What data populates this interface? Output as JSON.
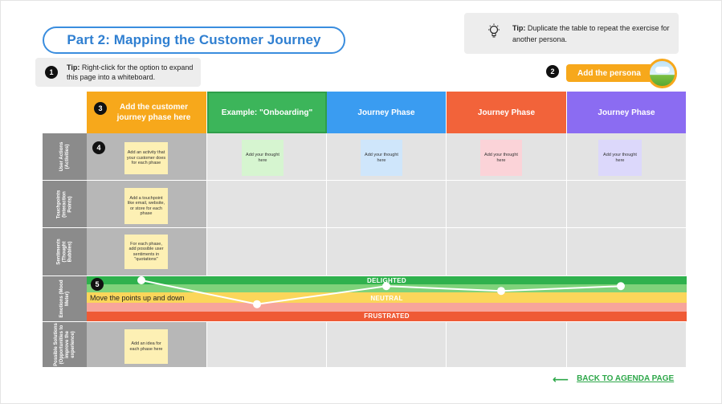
{
  "title": "Part 2: Mapping the Customer Journey",
  "tip_whiteboard": {
    "badge": "1",
    "prefix": "Tip:",
    "text": "Right-click for the option to expand this page into a whiteboard."
  },
  "tip_duplicate": {
    "prefix": "Tip:",
    "text": "Duplicate the table to repeat the exercise for another persona.",
    "icon": "lightbulb-icon"
  },
  "persona": {
    "badge": "2",
    "label": "Add the persona",
    "color": "#f7a81b"
  },
  "phases": [
    {
      "badge": "3",
      "label": "Add the customer journey phase here",
      "color": "#f7a81b"
    },
    {
      "label": "Example: \"Onboarding\"",
      "color": "#3cb55a"
    },
    {
      "label": "Journey Phase",
      "color": "#3a9cf1"
    },
    {
      "label": "Journey Phase",
      "color": "#f2633a"
    },
    {
      "label": "Journey Phase",
      "color": "#8b6cf2"
    }
  ],
  "rows": [
    {
      "label": "User Actions (Activities)"
    },
    {
      "label": "Touchpoints (Interaction Points)"
    },
    {
      "label": "Sentiments (Thought Bubbles)"
    },
    {
      "label": "Emotions (Mood Meter)"
    },
    {
      "label": "Possible Solutions (Opportunities to improve the experience)"
    }
  ],
  "notes": {
    "badge4": "4",
    "actions": "Add an activity that your customer does for each phase",
    "touchpoints": "Add a touchpoint like email, website, or store for each phase",
    "sentiments": "For each phase, add possible user sentiments in \"quotations\"",
    "solutions": "Add an idea for each phase here",
    "thought": "Add your thought here",
    "colors": {
      "yellow": "#fdf0b4",
      "green": "#d6f5d0",
      "blue": "#cfe6fb",
      "pink": "#fbd3d8",
      "purple": "#dcd8fb"
    }
  },
  "emotions": {
    "badge": "5",
    "delighted": "DELIGHTED",
    "neutral": "NEUTRAL",
    "frustrated": "FRUSTRATED",
    "instruction": "Move the points up and down",
    "points": [
      1.0,
      0.1,
      0.78,
      0.6,
      0.78
    ]
  },
  "back_link": "BACK TO AGENDA PAGE"
}
